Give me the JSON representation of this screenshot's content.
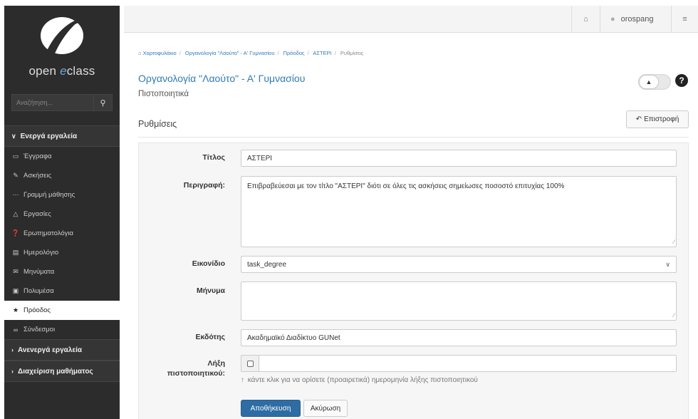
{
  "sidebar": {
    "brand_prefix": "open ",
    "brand_e": "e",
    "brand_suffix": "class",
    "search_placeholder": "Αναζήτηση...",
    "active_tools_header": "Ενεργά εργαλεία",
    "items": [
      {
        "label": "Έγγραφα",
        "icon": "folder-icon"
      },
      {
        "label": "Ασκήσεις",
        "icon": "edit-icon"
      },
      {
        "label": "Γραμμή μάθησης",
        "icon": "ellipsis-icon"
      },
      {
        "label": "Εργασίες",
        "icon": "flask-icon"
      },
      {
        "label": "Ερωτηματολόγια",
        "icon": "question-circle-icon"
      },
      {
        "label": "Ημερολόγιο",
        "icon": "calendar-icon"
      },
      {
        "label": "Μηνύματα",
        "icon": "envelope-icon"
      },
      {
        "label": "Πολυμέσα",
        "icon": "film-icon"
      },
      {
        "label": "Πρόοδος",
        "icon": "trophy-icon"
      },
      {
        "label": "Σύνδεσμοι",
        "icon": "link-icon"
      }
    ],
    "inactive_tools_header": "Ανενεργά εργαλεία",
    "course_admin_header": "Διαχείριση μαθήματος"
  },
  "topbar": {
    "username": "orospang"
  },
  "breadcrumb": {
    "items": [
      "Χαρτοφυλάκιο",
      "Οργανολογία \"Λαούτο\" - Α' Γυμνασίου",
      "Πρόοδος",
      "ΑΣΤΕΡΙ"
    ],
    "current": "Ρυθμίσεις"
  },
  "header": {
    "course_title": "Οργανολογία \"Λαούτο\" - Α' Γυμνασίου",
    "subtitle": "Πιστοποιητικά",
    "help": "?"
  },
  "section": {
    "title": "Ρυθμίσεις",
    "back_label": "Επιστροφή"
  },
  "form": {
    "title_label": "Τίτλος",
    "title_value": "ΑΣΤΕΡΙ",
    "description_label": "Περιγραφή:",
    "description_value": "Επιβραβεύεσαι με τον τίτλο \"ΑΣΤΕΡΙ\" διότι σε όλες τις ασκήσεις σημείωσες ποσοστό επιτυχίας 100%",
    "icon_label": "Εικονίδιο",
    "icon_value": "task_degree",
    "message_label": "Μήνυμα",
    "message_value": "",
    "issuer_label": "Εκδότης",
    "issuer_value": "Ακαδημαϊκό Διαδίκτυο GUNet",
    "expiry_label_1": "Λήξη",
    "expiry_label_2": "πιστοποιητικού:",
    "expiry_hint": "κάντε κλικ για να ορίσετε (προαιρετικά) ημερομηνία λήξης πιστοποιητικού",
    "save_label": "Αποθήκευση",
    "cancel_label": "Ακύρωση"
  }
}
